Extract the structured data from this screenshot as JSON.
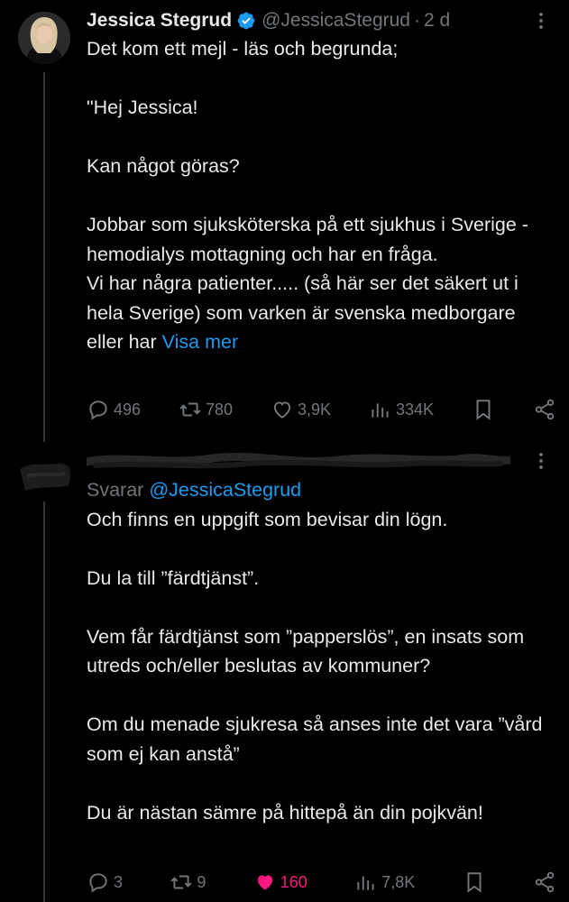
{
  "thread": [
    {
      "author": {
        "name": "Jessica Stegrud",
        "handle": "@JessicaStegrud",
        "verified": true
      },
      "time": "2 d",
      "paragraphs": [
        "Det kom ett mejl - läs och begrunda;",
        "\"Hej Jessica!",
        "Kan något göras?",
        "Jobbar som sjuksköterska på ett sjukhus i Sverige - hemodialys mottagning och har en fråga.\nVi har några patienter..... (så här ser det säkert ut i hela Sverige) som varken är svenska medborgare eller har"
      ],
      "show_more": "Visa mer",
      "actions": {
        "replies": "496",
        "reposts": "780",
        "likes": "3,9K",
        "views": "334K"
      }
    },
    {
      "replying_label": "Svarar",
      "replying_to": "@JessicaStegrud",
      "paragraphs": [
        "Och finns en uppgift som bevisar din lögn.",
        "Du la till ”färdtjänst”.",
        "Vem får färdtjänst som ”papperslös”, en insats som utreds och/eller beslutas av kommuner?",
        "Om du menade sjukresa så anses inte det vara  ”vård som ej kan anstå”",
        "Du är nästan sämre på hittepå än din pojkvän!"
      ],
      "actions": {
        "replies": "3",
        "reposts": "9",
        "likes": "160",
        "views": "7,8K",
        "liked": true
      }
    }
  ],
  "colors": {
    "background": "#000000",
    "text": "#e7e9ea",
    "muted": "#71767b",
    "link": "#1d9bf0",
    "like": "#f91880",
    "verified": "#1d9bf0"
  },
  "icons": [
    "verified-badge-icon",
    "more-icon",
    "reply-icon",
    "repost-icon",
    "like-icon",
    "views-icon",
    "bookmark-icon",
    "share-icon"
  ]
}
